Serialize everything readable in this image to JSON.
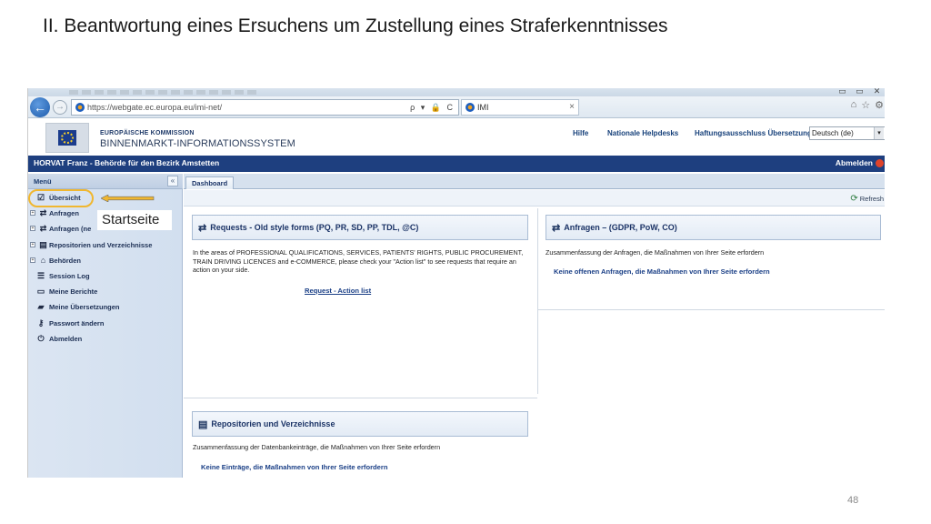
{
  "slide": {
    "title": "II. Beantwortung eines Ersuchens um Zustellung eines Straferkenntnisses",
    "page_number": "48"
  },
  "browser": {
    "url": "https://webgate.ec.europa.eu/imi-net/",
    "url_icons": "ρ ▾ 🔒 C",
    "tab_title": "IMI",
    "tab_close": "×",
    "window_controls": [
      "▭",
      "▭",
      "✕"
    ],
    "tools": [
      "⌂",
      "☆",
      "⚙"
    ],
    "colors": {
      "back_button": "#1d5bab"
    }
  },
  "imi_header": {
    "organization": "EUROPÄISCHE KOMMISSION",
    "system_name": "BINNENMARKT-INFORMATIONSSYSTEM",
    "links": {
      "help": "Hilfe",
      "helpdesks": "Nationale Helpdesks",
      "disclaimer": "Haftungsausschluss Übersetzung"
    },
    "language": {
      "selected": "Deutsch (de)",
      "caret": "▾"
    }
  },
  "userbar": {
    "user": "HORVAT Franz - Behörde für den Bezirk Amstetten",
    "logout": "Abmelden",
    "color": "#1e3f7f"
  },
  "sidebar": {
    "heading": "Menü",
    "collapse": "«",
    "items": [
      {
        "label": "Übersicht",
        "icon": "overview-icon",
        "glyph": "☑",
        "expandable": false
      },
      {
        "label": "Anfragen",
        "icon": "requests-icon",
        "glyph": "⇄",
        "expandable": true
      },
      {
        "label": "Anfragen (ne",
        "icon": "requests-new-icon",
        "glyph": "⇄",
        "expandable": true
      },
      {
        "label": "Repositorien und Verzeichnisse",
        "icon": "repository-icon",
        "glyph": "▤",
        "expandable": true
      },
      {
        "label": "Behörden",
        "icon": "authorities-icon",
        "glyph": "⌂",
        "expandable": true
      },
      {
        "label": "Session Log",
        "icon": "session-log-icon",
        "glyph": "☰",
        "expandable": false
      },
      {
        "label": "Meine Berichte",
        "icon": "reports-icon",
        "glyph": "▭",
        "expandable": false
      },
      {
        "label": "Meine Übersetzungen",
        "icon": "translations-icon",
        "glyph": "▰",
        "expandable": false
      },
      {
        "label": "Passwort ändern",
        "icon": "key-icon",
        "glyph": "⚷",
        "expandable": false
      },
      {
        "label": "Abmelden",
        "icon": "power-icon",
        "glyph": "⏻",
        "expandable": false
      }
    ],
    "expander_glyph": "+"
  },
  "annotation": {
    "label": "Startseite",
    "color": "#f0b730"
  },
  "main": {
    "tab": "Dashboard",
    "refresh": "Refresh",
    "panels": {
      "requests_old": {
        "icon": "transfer-icon",
        "title": "Requests - Old style forms (PQ, PR, SD, PP, TDL, @C)",
        "text": "In the areas of PROFESSIONAL QUALIFICATIONS, SERVICES, PATIENTS' RIGHTS, PUBLIC PROCUREMENT, TRAIN DRIVING LICENCES and e-COMMERCE, please check your \"Action list\" to see requests that require an action on your side.",
        "link": "Request - Action list"
      },
      "anfragen": {
        "icon": "transfer-icon",
        "title": "Anfragen – (GDPR, PoW, CO)",
        "text": "Zusammenfassung der Anfragen, die Maßnahmen von Ihrer Seite erfordern",
        "link": "Keine offenen Anfragen, die Maßnahmen von Ihrer Seite erfordern"
      },
      "repositories": {
        "icon": "repository-icon",
        "title": "Repositorien und Verzeichnisse",
        "text": "Zusammenfassung der Datenbankeinträge, die Maßnahmen von Ihrer Seite erfordern",
        "link": "Keine Einträge, die Maßnahmen von Ihrer Seite erfordern"
      }
    }
  }
}
